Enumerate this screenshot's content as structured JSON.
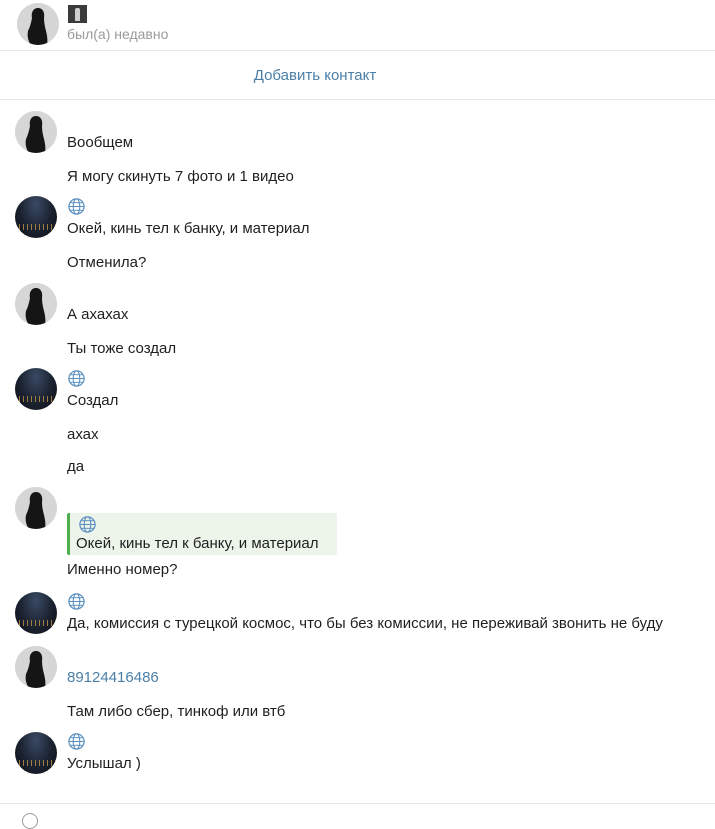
{
  "header": {
    "status": "был(а) недавно"
  },
  "add_contact": {
    "label": "Добавить контакт"
  },
  "messages": [
    {
      "text": "Вообщем"
    },
    {
      "text": "Я могу скинуть 7 фото и 1 видео"
    },
    {
      "text": "Окей, кинь тел к банку, и материал"
    },
    {
      "text": "Отменила?"
    },
    {
      "text": "А ахахах"
    },
    {
      "text": "Ты тоже создал"
    },
    {
      "text": "Создал"
    },
    {
      "text": "ахах"
    },
    {
      "text": "да"
    },
    {
      "text": "Именно номер?"
    },
    {
      "text": "Да, комиссия с турецкой космос, что бы без комиссии, не переживай звонить не буду"
    },
    {
      "text": "89124416486"
    },
    {
      "text": "Там либо сбер, тинкоф или втб"
    },
    {
      "text": "Услышал )"
    }
  ],
  "quote": {
    "text": "Окей, кинь тел к банку, и материал"
  },
  "icons": {
    "avatar_light": "woman-silhouette-avatar",
    "avatar_dark": "night-city-avatar",
    "flag": "globe-icon"
  },
  "colors": {
    "link": "#4a7fa8",
    "quote_border": "#4fae4e",
    "quote_bg": "#edf4ea"
  }
}
